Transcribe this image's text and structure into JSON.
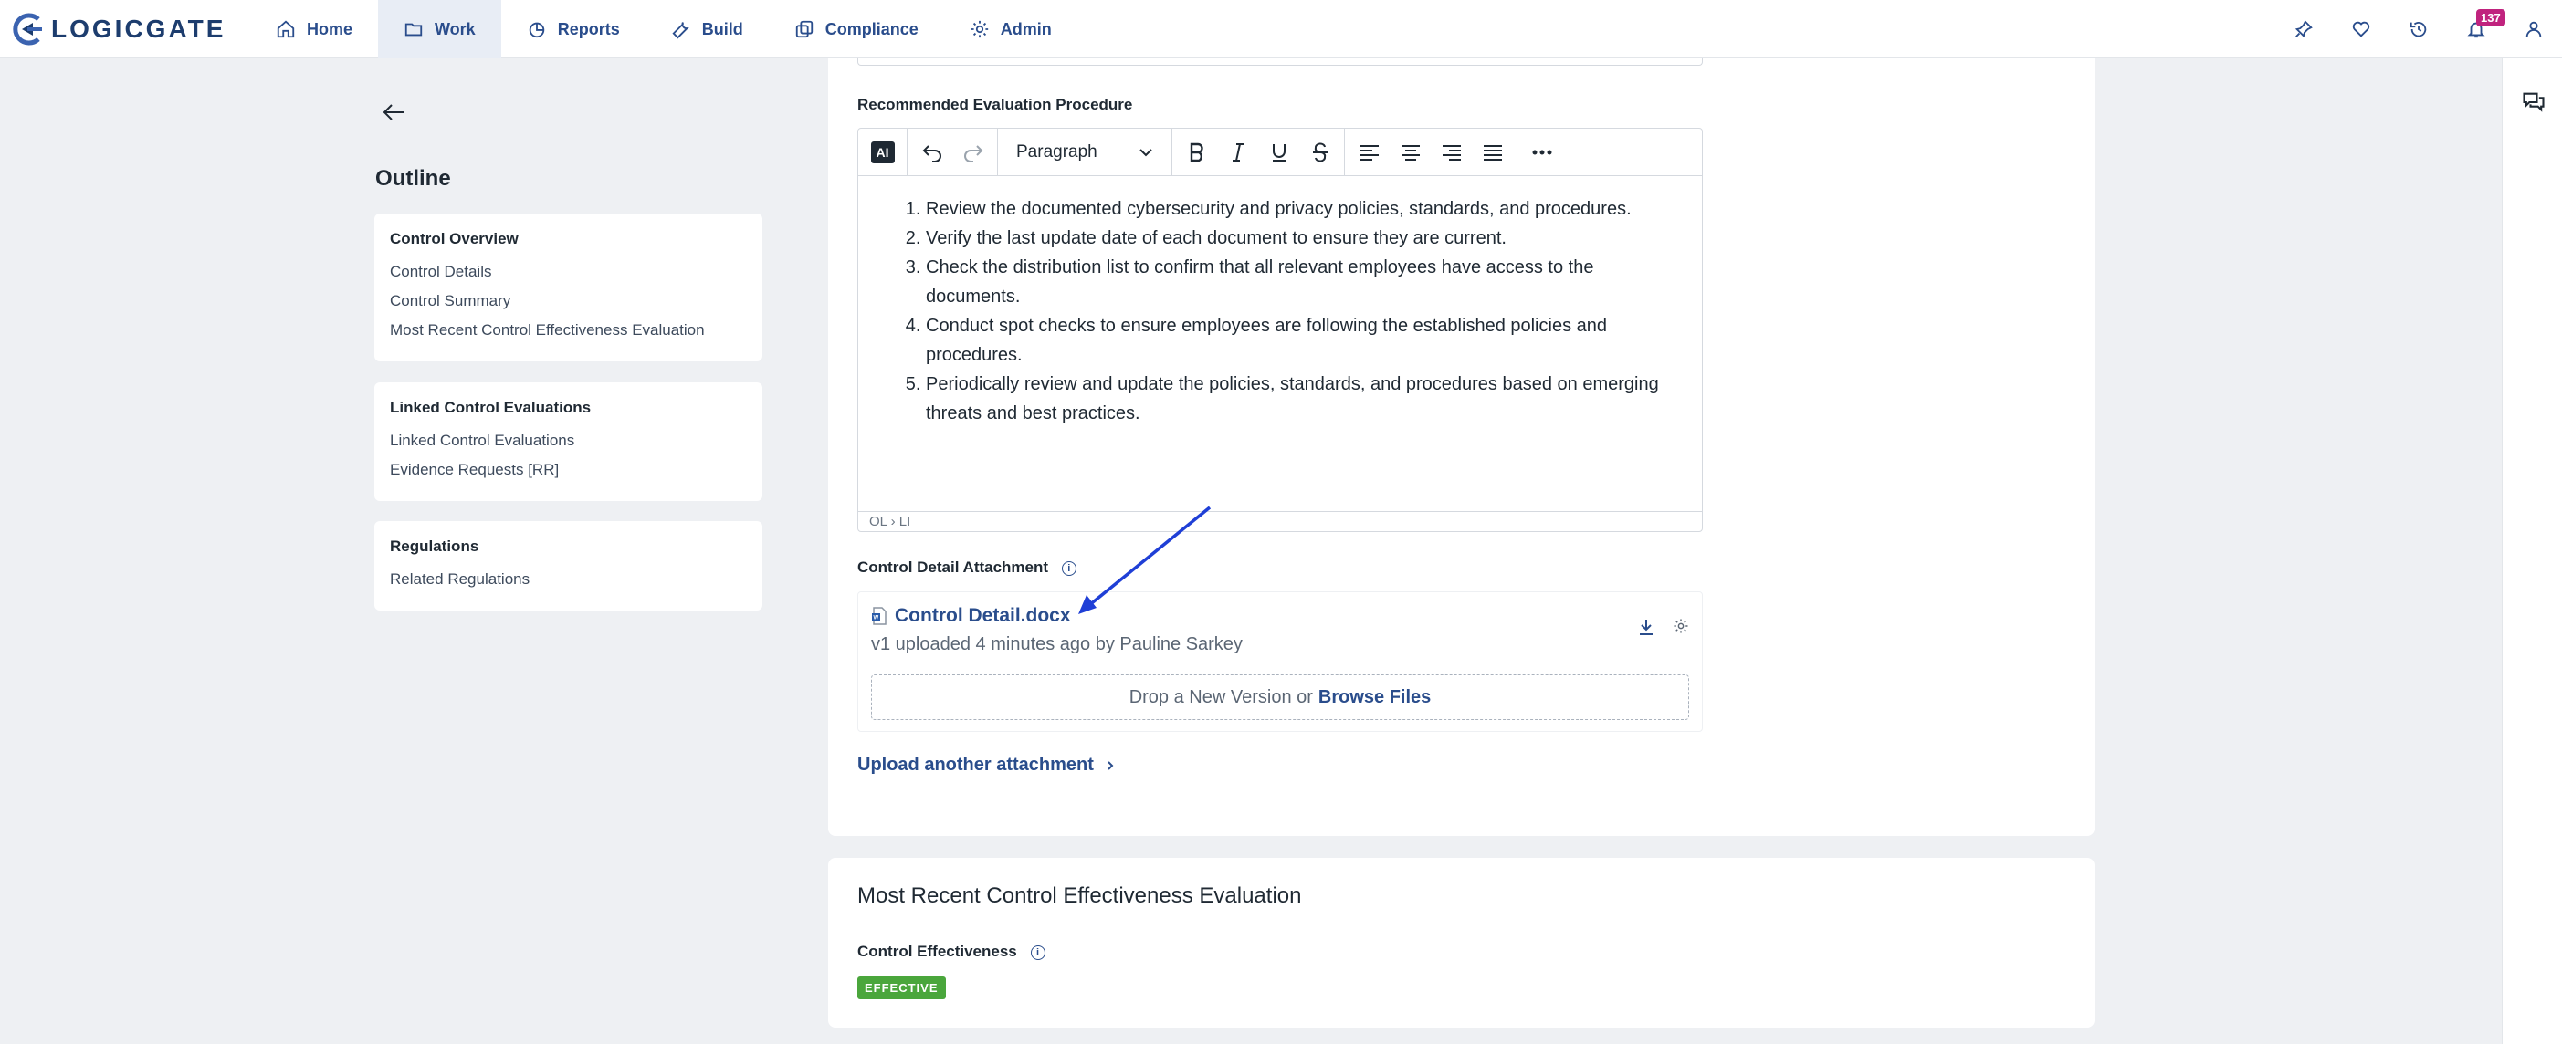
{
  "app": {
    "logo_text": "LOGICGATE"
  },
  "nav": {
    "items": [
      {
        "label": "Home",
        "icon": "home-icon"
      },
      {
        "label": "Work",
        "icon": "folder-icon",
        "active": true
      },
      {
        "label": "Reports",
        "icon": "chart-icon"
      },
      {
        "label": "Build",
        "icon": "wrench-icon"
      },
      {
        "label": "Compliance",
        "icon": "copy-icon"
      },
      {
        "label": "Admin",
        "icon": "gear-icon"
      }
    ],
    "notification_count": "137"
  },
  "outline": {
    "title": "Outline",
    "sections": [
      {
        "heading": "Control Overview",
        "links": [
          "Control Details",
          "Control Summary",
          "Most Recent Control Effectiveness Evaluation"
        ]
      },
      {
        "heading": "Linked Control Evaluations",
        "links": [
          "Linked Control Evaluations",
          "Evidence Requests [RR]"
        ]
      },
      {
        "heading": "Regulations",
        "links": [
          "Related Regulations"
        ]
      }
    ]
  },
  "editor": {
    "label": "Recommended Evaluation Procedure",
    "ai_label": "AI",
    "block_format": "Paragraph",
    "items": [
      "Review the documented cybersecurity and privacy policies, standards, and procedures.",
      "Verify the last update date of each document to ensure they are current.",
      "Check the distribution list to confirm that all relevant employees have access to the documents.",
      "Conduct spot checks to ensure employees are following the established policies and procedures.",
      "Periodically review and update the policies, standards, and procedures based on emerging threats and best practices."
    ],
    "path": "OL › LI"
  },
  "attachment": {
    "label": "Control Detail Attachment",
    "file_name": "Control Detail.docx",
    "meta": "v1 uploaded 4 minutes ago by Pauline Sarkey",
    "drop_text": "Drop a New Version or",
    "browse_label": "Browse Files",
    "upload_another": "Upload another attachment"
  },
  "evaluation": {
    "title": "Most Recent Control Effectiveness Evaluation",
    "field_label": "Control Effectiveness",
    "status": "EFFECTIVE"
  },
  "colors": {
    "accent": "#2a4d8c",
    "effective": "#4aa63c",
    "badge": "#c0237e",
    "annotation": "#1f3fd6"
  }
}
